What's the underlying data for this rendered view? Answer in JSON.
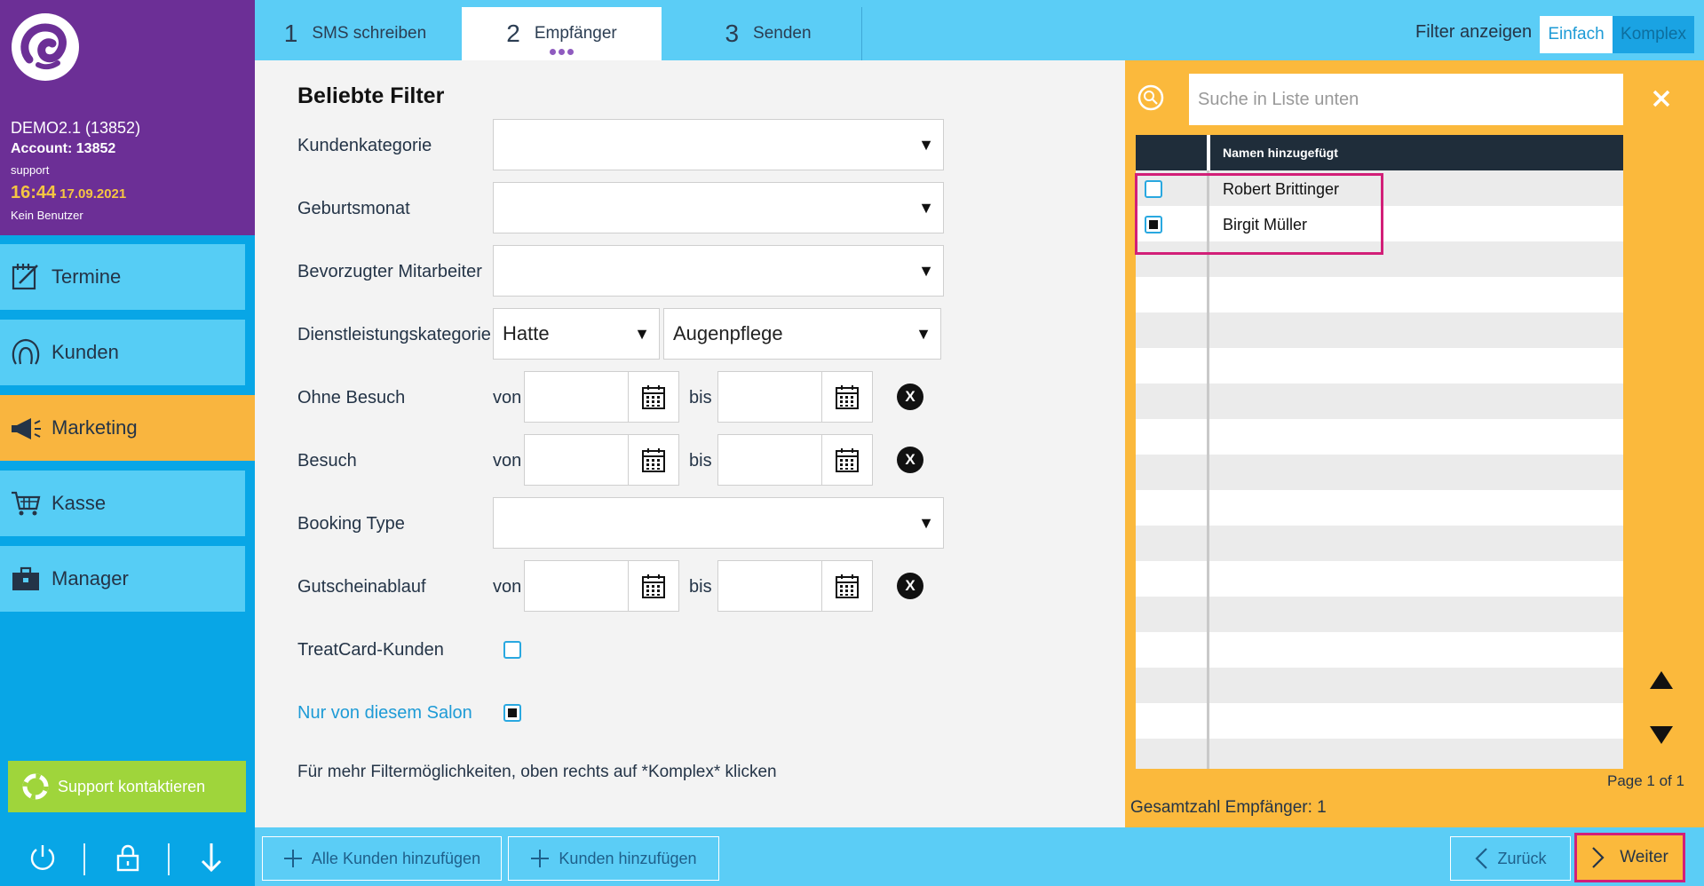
{
  "sidebar": {
    "account_name": "DEMO2.1 (13852)",
    "account_id": "Account: 13852",
    "role": "support",
    "time": "16:44",
    "date": "17.09.2021",
    "user": "Kein Benutzer",
    "nav": [
      {
        "label": "Termine",
        "icon": "calendar-edit-icon"
      },
      {
        "label": "Kunden",
        "icon": "customer-head-icon"
      },
      {
        "label": "Marketing",
        "icon": "megaphone-icon",
        "active": true
      },
      {
        "label": "Kasse",
        "icon": "cart-icon"
      },
      {
        "label": "Manager",
        "icon": "briefcase-icon"
      }
    ],
    "support_label": "Support kontaktieren"
  },
  "header": {
    "steps": [
      {
        "num": "1",
        "label": "SMS schreiben"
      },
      {
        "num": "2",
        "label": "Empfänger",
        "active": true
      },
      {
        "num": "3",
        "label": "Senden"
      }
    ],
    "filter_label": "Filter anzeigen",
    "mode_simple": "Einfach",
    "mode_complex": "Komplex"
  },
  "filters": {
    "title": "Beliebte Filter",
    "kundenkategorie": {
      "label": "Kundenkategorie",
      "value": ""
    },
    "geburtsmonat": {
      "label": "Geburtsmonat",
      "value": ""
    },
    "mitarbeiter": {
      "label": "Bevorzugter Mitarbeiter",
      "value": ""
    },
    "dienstleistung": {
      "label": "Dienstleistungskategorie",
      "value1": "Hatte",
      "value2": "Augenpflege"
    },
    "ohne_besuch": {
      "label": "Ohne Besuch"
    },
    "besuch": {
      "label": "Besuch"
    },
    "booking_type": {
      "label": "Booking Type",
      "value": ""
    },
    "gutschein": {
      "label": "Gutscheinablauf"
    },
    "von": "von",
    "bis": "bis",
    "clear": "X",
    "treatcard": {
      "label": "TreatCard-Kunden",
      "checked": false
    },
    "nur_salon": {
      "label": "Nur von diesem Salon",
      "checked": true
    },
    "hint": "Für mehr Filtermöglichkeiten, oben rechts auf *Komplex* klicken"
  },
  "recipients": {
    "search_placeholder": "Suche in Liste unten",
    "column_header": "Namen hinzugefügt",
    "rows": [
      {
        "name": "Robert Brittinger",
        "checked": false
      },
      {
        "name": "Birgit Müller",
        "checked": true
      }
    ],
    "page_info": "Page 1 of 1",
    "total": "Gesamtzahl Empfänger: 1"
  },
  "footer": {
    "add_all": "Alle Kunden hinzufügen",
    "add": "Kunden hinzufügen",
    "back": "Zurück",
    "next": "Weiter"
  },
  "colors": {
    "sidebar_purple": "#6c2f96",
    "sidebar_blue": "#08a6e6",
    "nav_light": "#56cdf5",
    "active_orange": "#f9b53f",
    "highlight_magenta": "#d21f78",
    "support_green": "#9fd53b"
  }
}
